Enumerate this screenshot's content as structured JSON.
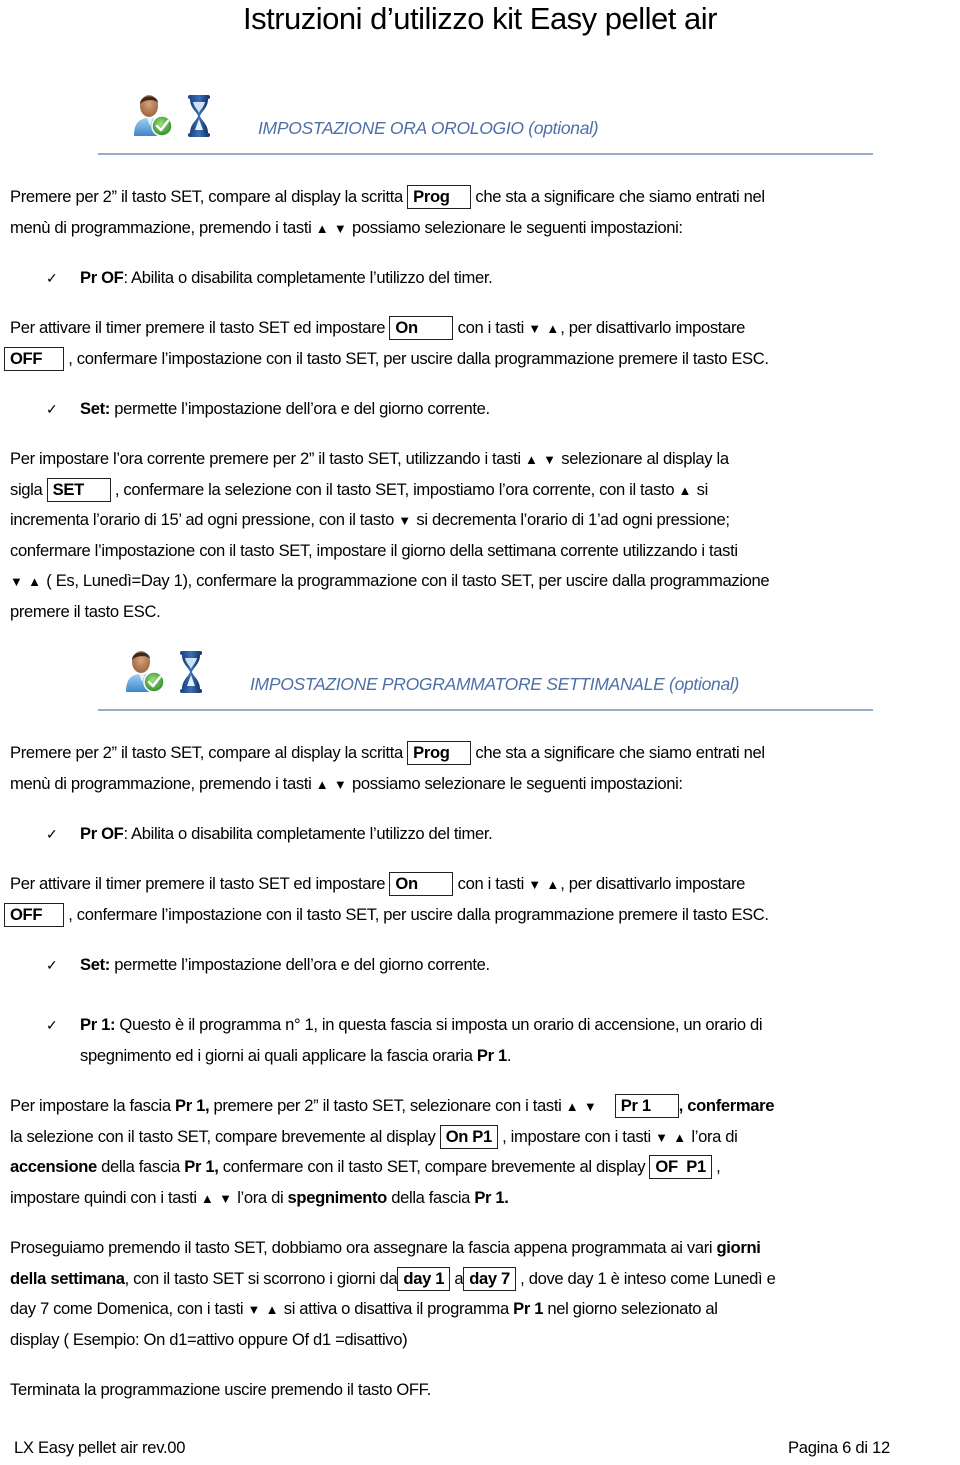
{
  "document": {
    "title": "Istruzioni d’utilizzo kit Easy pellet air"
  },
  "icons": {
    "user": "user-check-icon",
    "hourglass": "hourglass-icon",
    "check": "✓",
    "up": "▲",
    "down": "▼"
  },
  "section1": {
    "heading": "IMPOSTAZIONE ORA OROLOGIO (optional)",
    "intro": {
      "t1": "Premere per 2” il tasto  SET, compare al display la scritta ",
      "box1": "Prog",
      "t2": " che sta a significare che siamo entrati nel",
      "t3": "menù di programmazione, premendo i tasti ",
      "t4": " possiamo selezionare le seguenti impostazioni:"
    },
    "bullet_prof": {
      "label": "Pr  OF",
      "text": ": Abilita o disabilita completamente l’utilizzo del timer."
    },
    "activate": {
      "t1": "Per attivare il timer premere il tasto SET ed impostare ",
      "box_on": "On",
      "t2": " con i tasti ",
      "t3": ", per disattivarlo impostare",
      "box_off": "OFF",
      "t4": ", confermare l’impostazione con il tasto SET,  per uscire dalla programmazione premere il tasto ESC."
    },
    "bullet_set": {
      "label": "Set:",
      "text": " permette l’impostazione dell’ora e del giorno corrente."
    },
    "set_hour": {
      "l1a": "Per impostare l’ora corrente premere per 2” il tasto SET, utilizzando i tasti ",
      "l1b": " selezionare al display la",
      "l2a": "sigla ",
      "box_set": "SET",
      "l2b": " , confermare la selezione con il tasto SET, impostiamo l’ora corrente, con il tasto ",
      "l2c": " si",
      "l3a": "incrementa l’orario di 15’ ad ogni pressione, con il tasto ",
      "l3b": " si decrementa l’orario di 1’ad ogni pressione;",
      "l4": "confermare l’impostazione con il tasto SET, impostare il giorno della settimana corrente utilizzando i tasti",
      "l5": " ( Es, Lunedì=Day 1), confermare la programmazione con il tasto SET, per uscire dalla programmazione",
      "l6": "premere il tasto ESC."
    }
  },
  "section2": {
    "heading": "IMPOSTAZIONE PROGRAMMATORE SETTIMANALE (optional)",
    "intro": {
      "t1": "Premere per 2” il tasto  SET, compare al display la scritta ",
      "box1": "Prog",
      "t2": " che sta a significare che siamo entrati nel",
      "t3": "menù di programmazione, premendo i tasti ",
      "t4": " possiamo selezionare le seguenti impostazioni:"
    },
    "bullet_prof": {
      "label": "Pr  OF",
      "text": ": Abilita o disabilita completamente l’utilizzo del timer."
    },
    "activate": {
      "t1": "Per attivare il timer premere il tasto SET ed impostare ",
      "box_on": "On",
      "t2": " con i tasti ",
      "t3": ", per disattivarlo impostare",
      "box_off": "OFF",
      "t4": ", confermare l’impostazione con il tasto SET,  per uscire dalla programmazione premere il tasto ESC."
    },
    "bullet_set": {
      "label": "Set:",
      "text": " permette l’impostazione dell’ora e del giorno corrente."
    },
    "bullet_pr1": {
      "label": "Pr  1:",
      "text": " Questo è il programma  n° 1, in questa fascia si imposta un orario di accensione, un orario di",
      "cont": "spegnimento ed i giorni ai quali applicare la fascia oraria ",
      "cont_bold": "Pr 1",
      "cont_end": "."
    },
    "set_pr1": {
      "l1a": "Per impostare la fascia ",
      "l1b": "Pr 1,",
      "l1c": " premere per 2” il tasto SET, selezionare con i tasti ",
      "box_pr1": "Pr 1",
      "l1d": ", confermare",
      "l2a": "la selezione con il tasto SET, compare brevemente al display ",
      "box_onp1": "On P1",
      "l2b": " , impostare con i tasti ",
      "l2c": " l’ora di",
      "l3a": "accensione",
      "l3b": " della fascia ",
      "l3c": "Pr 1,",
      "l3d": " confermare con il tasto SET, compare brevemente al display ",
      "box_ofp1": "OF  P1",
      "l3e": " ,",
      "l4a": "impostare quindi con i tasti ",
      "l4b": " l’ora di ",
      "l4c": "spegnimento",
      "l4d": " della fascia ",
      "l4e": "Pr 1."
    },
    "days": {
      "l1a": "Proseguiamo premendo il tasto SET, dobbiamo ora assegnare la fascia appena programmata ai vari ",
      "l1b": "giorni",
      "l2a": "della settimana",
      "l2b": ", con il tasto SET si scorrono i giorni da",
      "box_day1": "day 1",
      "l2c": " a",
      "box_day7": "day 7",
      "l2d": " , dove day 1 è inteso come Lunedì e",
      "l3a": "day 7 come Domenica, con i tasti ",
      "l3b": " si attiva o disattiva il programma ",
      "l3c": "Pr 1",
      "l3d": " nel giorno selezionato al",
      "l4": "display ( Esempio: On d1=attivo oppure Of d1 =disattivo)"
    },
    "end": "Terminata la programmazione uscire premendo il tasto OFF."
  },
  "footer": {
    "left": "LX Easy pellet air rev.00",
    "right": "Pagina 6 di 12"
  },
  "colors": {
    "heading": "#4f6fa8",
    "rule": "#95adc9"
  }
}
